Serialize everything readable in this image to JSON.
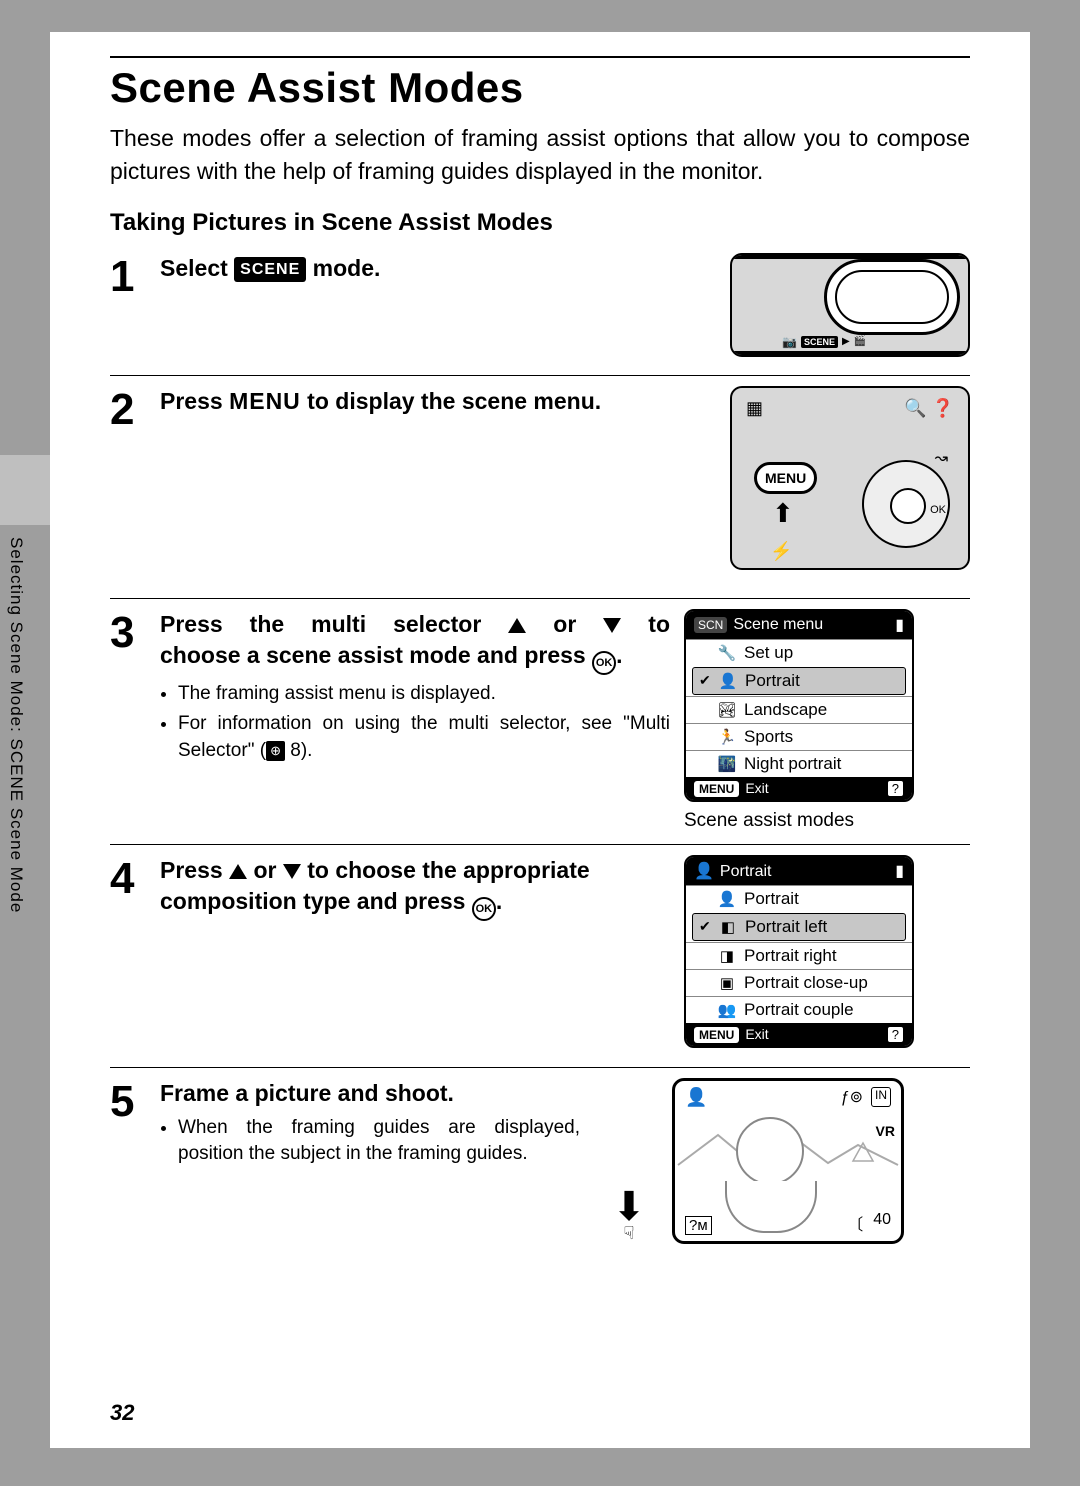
{
  "page": {
    "title": "Scene Assist Modes",
    "intro": "These modes offer a selection of framing assist options that allow you to compose pictures with the help of framing guides displayed in the monitor.",
    "subtitle": "Taking Pictures in Scene Assist Modes",
    "side_label": "Selecting Scene Mode: SCENE Scene Mode",
    "page_number": "32"
  },
  "inline": {
    "scene_chip": "SCENE",
    "menu_word": "MENU",
    "ok_label": "OK",
    "ref_page": "8"
  },
  "steps": [
    {
      "num": "1",
      "title_pre": "Select ",
      "title_post": " mode."
    },
    {
      "num": "2",
      "title_pre": "Press ",
      "title_post": " to display the scene menu."
    },
    {
      "num": "3",
      "title_line1_pre": "Press the multi selector ",
      "title_line1_mid": " or ",
      "title_line1_post": " to",
      "title_line2_pre": "choose a scene assist mode and press ",
      "title_line2_post": ".",
      "bullets": [
        "The framing assist menu is displayed.",
        "For information on using the multi selector, see \"Multi Selector\" ("
      ],
      "bullet2_post": " 8)."
    },
    {
      "num": "4",
      "title_line1_pre": "Press ",
      "title_line1_mid": " or ",
      "title_line1_post": " to choose the appropriate",
      "title_line2_pre": "composition type and press ",
      "title_line2_post": "."
    },
    {
      "num": "5",
      "title": "Frame a picture and shoot.",
      "bullet": "When the framing guides are displayed, position the subject in the framing guides."
    }
  ],
  "lcd_scene_menu": {
    "header_tag": "SCN",
    "header_title": "Scene menu",
    "rows": [
      {
        "icon": "🔧",
        "label": "Set up",
        "selected": false
      },
      {
        "icon": "👤",
        "label": "Portrait",
        "selected": true
      },
      {
        "icon": "🏞",
        "label": "Landscape",
        "selected": false
      },
      {
        "icon": "🏃",
        "label": "Sports",
        "selected": false
      },
      {
        "icon": "🌃",
        "label": "Night portrait",
        "selected": false
      }
    ],
    "footer_menu": "MENU",
    "footer_exit": "Exit",
    "footer_help": "?",
    "caption": "Scene assist modes"
  },
  "lcd_portrait_menu": {
    "header_icon": "👤",
    "header_title": "Portrait",
    "rows": [
      {
        "icon": "👤",
        "label": "Portrait",
        "selected": false
      },
      {
        "icon": "◧",
        "label": "Portrait left",
        "selected": true
      },
      {
        "icon": "◨",
        "label": "Portrait right",
        "selected": false
      },
      {
        "icon": "▣",
        "label": "Portrait close-up",
        "selected": false
      },
      {
        "icon": "👥",
        "label": "Portrait couple",
        "selected": false
      }
    ],
    "footer_menu": "MENU",
    "footer_exit": "Exit",
    "footer_help": "?"
  },
  "viewfinder": {
    "top_left_icon": "👤",
    "top_right_icon1": "ƒ⊚",
    "top_right_icon2": "IN",
    "vr_label": "VR",
    "bottom_left": "?м",
    "bottom_right1": "〔",
    "bottom_right2": "40"
  },
  "cam_back": {
    "menu_label": "MENU",
    "ok_label": "OK"
  }
}
